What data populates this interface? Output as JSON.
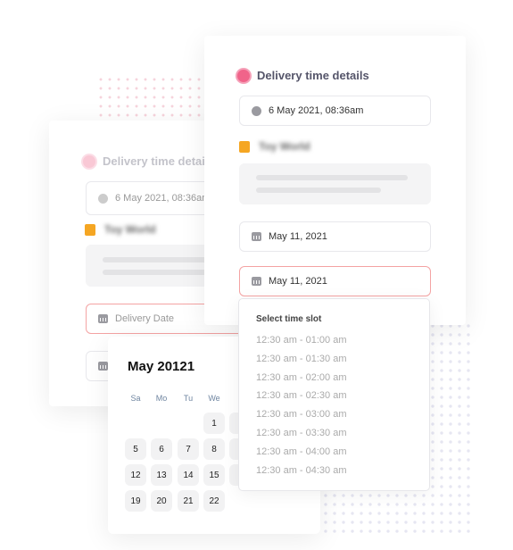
{
  "back_card": {
    "title": "Delivery time details",
    "created": "6 May 2021, 08:36am",
    "store": "Toy World",
    "delivery_date_placeholder": "Delivery Date"
  },
  "front_card": {
    "title": "Delivery time details",
    "created": "6 May 2021, 08:36am",
    "store": "Toy World",
    "date1": "May 11, 2021",
    "date2": "May 11, 2021"
  },
  "calendar": {
    "title": "May 20121",
    "weekdays": [
      "Sa",
      "Mo",
      "Tu",
      "We"
    ],
    "rows": [
      [
        "",
        "",
        "",
        "1",
        ""
      ],
      [
        "5",
        "6",
        "7",
        "8",
        ""
      ],
      [
        "12",
        "13",
        "14",
        "15",
        ""
      ],
      [
        "19",
        "20",
        "21",
        "22"
      ]
    ]
  },
  "time_slots": {
    "title": "Select time slot",
    "options": [
      "12:30 am - 01:00 am",
      "12:30 am - 01:30 am",
      "12:30 am - 02:00 am",
      "12:30 am - 02:30 am",
      "12:30 am - 03:00 am",
      "12:30 am - 03:30 am",
      "12:30 am - 04:00 am",
      "12:30 am - 04:30 am"
    ]
  },
  "colors": {
    "accent_pink": "#f0648a",
    "active_border": "#f4a3a3",
    "bag": "#f5a623"
  }
}
